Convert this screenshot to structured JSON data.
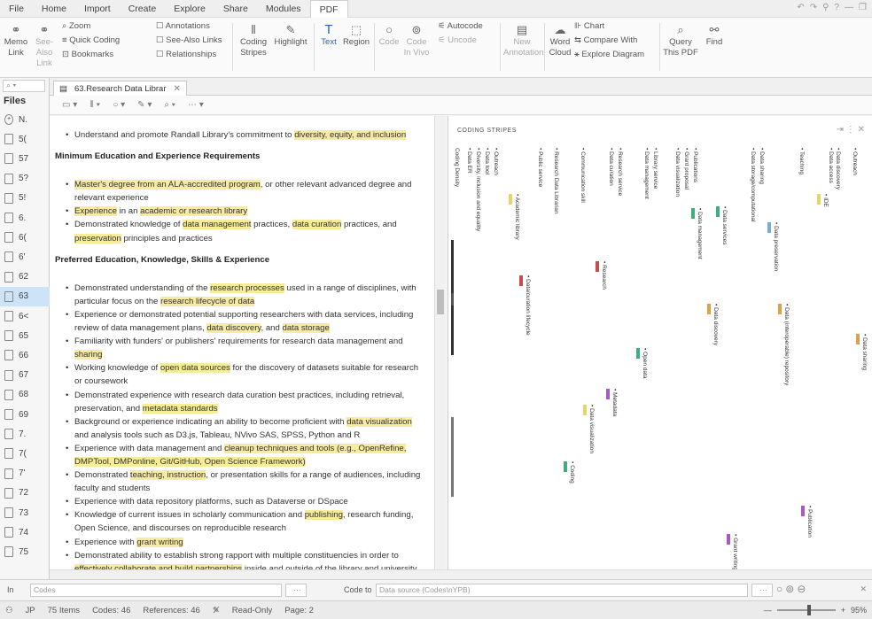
{
  "menu": [
    "File",
    "Home",
    "Import",
    "Create",
    "Explore",
    "Share",
    "Modules",
    "PDF"
  ],
  "active_menu": "PDF",
  "ribbon": {
    "memo_link": "Memo\nLink",
    "see_also_link": "See-Also\nLink",
    "zoom": "Zoom",
    "quick_coding": "Quick Coding",
    "bookmarks": "Bookmarks",
    "annotations": "Annotations",
    "see_also_links": "See-Also Links",
    "relationships": "Relationships",
    "coding_stripes": "Coding\nStripes",
    "highlight": "Highlight",
    "text": "Text",
    "region": "Region",
    "code": "Code",
    "code_in_vivo": "Code\nIn Vivo",
    "autocode": "Autocode",
    "uncode": "Uncode",
    "new_annotation": "New\nAnnotation",
    "word_cloud": "Word\nCloud",
    "chart": "Chart",
    "compare_with": "Compare With",
    "explore_diagram": "Explore Diagram",
    "query_this_pdf": "Query\nThis PDF",
    "find": "Find"
  },
  "nav": {
    "title": "Files",
    "rows": [
      "N.",
      "5(",
      "57",
      "5?",
      "5!",
      "6.",
      "6(",
      "6'",
      "62",
      "63",
      "6<",
      "65",
      "66",
      "67",
      "68",
      "69",
      "7.",
      "7(",
      "7'",
      "72",
      "73",
      "74",
      "75"
    ],
    "selected_index": 9
  },
  "doc_tab": "63.Research Data Librar",
  "document": [
    {
      "t": "li",
      "parts": [
        [
          "Understand and promote Randall Library's commitment to ",
          false
        ],
        [
          "diversity, equity, and inclusion",
          true
        ]
      ]
    },
    {
      "t": "h",
      "parts": [
        [
          "Minimum Education and Experience Requirements",
          false
        ]
      ]
    },
    {
      "t": "li",
      "parts": [
        [
          "Master's degree from an ALA-accredited program",
          true
        ],
        [
          ", or other relevant advanced degree and relevant experience",
          false
        ]
      ]
    },
    {
      "t": "li",
      "parts": [
        [
          "Experience",
          true
        ],
        [
          " in an ",
          false
        ],
        [
          "academic or research library",
          true
        ]
      ]
    },
    {
      "t": "li",
      "parts": [
        [
          "Demonstrated knowledge of ",
          false
        ],
        [
          "data management",
          true
        ],
        [
          " practices, ",
          false
        ],
        [
          "data curation",
          true
        ],
        [
          " practices, and ",
          false
        ],
        [
          "preservation",
          true
        ],
        [
          " principles and practices",
          false
        ]
      ]
    },
    {
      "t": "h",
      "parts": [
        [
          "Preferred Education, Knowledge, Skills & Experience",
          false
        ]
      ]
    },
    {
      "t": "li",
      "parts": [
        [
          "Demonstrated understanding of the ",
          false
        ],
        [
          "research processes",
          true
        ],
        [
          " used in a range of disciplines, with particular focus on the ",
          false
        ],
        [
          "research lifecycle of data",
          true
        ]
      ]
    },
    {
      "t": "li",
      "parts": [
        [
          "Experience or demonstrated potential supporting researchers with data services, including review of data management plans, ",
          false
        ],
        [
          "data discovery",
          true
        ],
        [
          ", and ",
          false
        ],
        [
          "data storage",
          true
        ]
      ]
    },
    {
      "t": "li",
      "parts": [
        [
          "Familiarity with funders' or publishers' requirements for research data management and ",
          false
        ],
        [
          "sharing",
          true
        ]
      ]
    },
    {
      "t": "li",
      "parts": [
        [
          "Working knowledge of ",
          false
        ],
        [
          "open data sources",
          true
        ],
        [
          " for the discovery of datasets suitable for research or coursework",
          false
        ]
      ]
    },
    {
      "t": "li",
      "parts": [
        [
          "Demonstrated experience with research data curation best practices, including retrieval, preservation, and ",
          false
        ],
        [
          "metadata standards",
          true
        ]
      ]
    },
    {
      "t": "li",
      "parts": [
        [
          "Background or experience indicating an ability to become proficient with ",
          false
        ],
        [
          "data visualization",
          true
        ],
        [
          " and analysis tools such as D3.js, Tableau, NVivo SAS, SPSS, Python and R",
          false
        ]
      ]
    },
    {
      "t": "li",
      "parts": [
        [
          "Experience with data management and ",
          false
        ],
        [
          "cleanup techniques and tools (e.g., OpenRefine, DMPTool, DMPonline, Git/GitHub, Open Science Framework)",
          true
        ]
      ]
    },
    {
      "t": "li",
      "parts": [
        [
          "Demonstrated ",
          false
        ],
        [
          "teaching, instruction",
          true
        ],
        [
          ", or presentation skills for a range of audiences, including faculty and students",
          false
        ]
      ]
    },
    {
      "t": "li",
      "parts": [
        [
          "Experience with data repository platforms, such as Dataverse or DSpace",
          false
        ]
      ]
    },
    {
      "t": "li",
      "parts": [
        [
          "Knowledge of current issues in scholarly communication and ",
          false
        ],
        [
          "publishing",
          true
        ],
        [
          ", research funding, Open Science, and discourses on reproducible research",
          false
        ]
      ]
    },
    {
      "t": "li",
      "parts": [
        [
          "Experience with ",
          false
        ],
        [
          "grant writing",
          true
        ]
      ]
    },
    {
      "t": "li",
      "parts": [
        [
          "Demonstrated ability to establish strong rapport with multiple constituencies in order to ",
          false
        ],
        [
          "effectively collaborate and build partnerships",
          true
        ],
        [
          " inside and outside of the library and university",
          false
        ]
      ]
    }
  ],
  "stripes": {
    "title": "CODING STRIPES",
    "labels": [
      "Coding Density",
      "• Data ER",
      "• Diversity, inclusion and equality",
      "• Data tool",
      "• Outreach",
      "• Public service",
      "• Research Data Librarian",
      "• Communication skill",
      "• Data curation",
      "• Research service",
      "• Data management",
      "• Library service",
      "• Data visualization",
      "• Grant proposal",
      "• Publications",
      "• Data storage/computational",
      "• Data sharing",
      "• Teaching",
      "• Data access",
      "• Data discovery",
      "• Outreach"
    ],
    "bar_labels": [
      "• Academic library",
      "• Data/curation lifecycle",
      "• Research",
      "• Data management",
      "• Data services",
      "• Data preservation",
      "• Data discovery",
      "• Open data",
      "• Metadata",
      "• Data visualization",
      "• Coding",
      "• Data (interoperable) repository",
      "• Publication",
      "• Grant writing",
      "• Data sharing",
      "• IDE"
    ],
    "colors": {
      "yellow": "#e6d466",
      "red": "#c94b4b",
      "orange": "#d9a24b",
      "green": "#3fae7a",
      "blue": "#7aaad6",
      "purple": "#a45cc2"
    }
  },
  "coding_bar": {
    "in_label": "In",
    "in_placeholder": "Codes",
    "code_to_label": "Code to",
    "code_to_placeholder": "Data source (Codes\\nYPB)"
  },
  "status": {
    "user": "JP",
    "items": "75 Items",
    "codes": "Codes: 46",
    "references": "References: 46",
    "read_only": "Read-Only",
    "page": "Page: 2",
    "zoom_pct": "95%",
    "zoom_fraction": 0.55
  }
}
